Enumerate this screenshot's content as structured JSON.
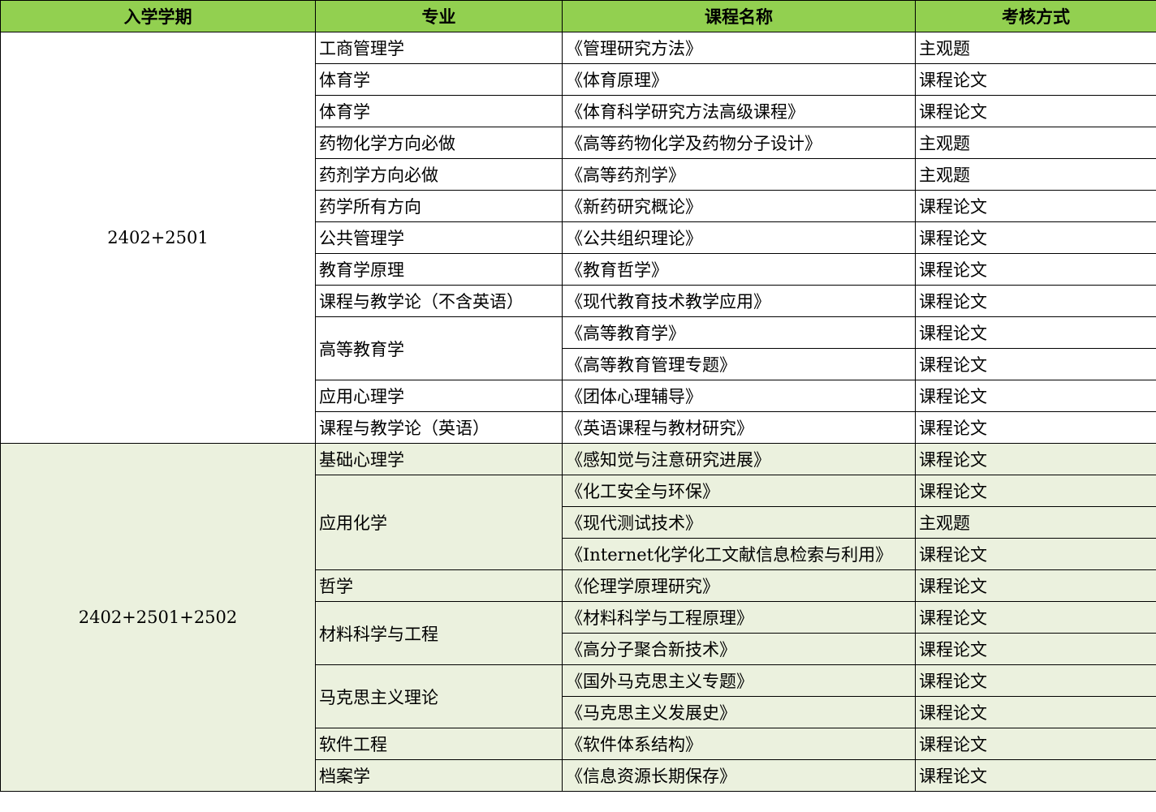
{
  "headers": [
    "入学学期",
    "专业",
    "课程名称",
    "考核方式"
  ],
  "groups": [
    {
      "term": "2402+2501",
      "majors": [
        {
          "name": "工商管理学",
          "courses": [
            {
              "course": "《管理研究方法》",
              "method": "主观题"
            }
          ]
        },
        {
          "name": "体育学",
          "courses": [
            {
              "course": "《体育原理》",
              "method": "课程论文"
            }
          ]
        },
        {
          "name": "体育学",
          "courses": [
            {
              "course": "《体育科学研究方法高级课程》",
              "method": "课程论文"
            }
          ]
        },
        {
          "name": "药物化学方向必做",
          "courses": [
            {
              "course": "《高等药物化学及药物分子设计》",
              "method": "主观题"
            }
          ]
        },
        {
          "name": "药剂学方向必做",
          "courses": [
            {
              "course": "《高等药剂学》",
              "method": "主观题"
            }
          ]
        },
        {
          "name": "药学所有方向",
          "courses": [
            {
              "course": "《新药研究概论》",
              "method": "课程论文"
            }
          ]
        },
        {
          "name": "公共管理学",
          "courses": [
            {
              "course": "《公共组织理论》",
              "method": "课程论文"
            }
          ]
        },
        {
          "name": "教育学原理",
          "courses": [
            {
              "course": "《教育哲学》",
              "method": "课程论文"
            }
          ]
        },
        {
          "name": "课程与教学论（不含英语）",
          "courses": [
            {
              "course": "《现代教育技术教学应用》",
              "method": "课程论文"
            }
          ]
        },
        {
          "name": "高等教育学",
          "courses": [
            {
              "course": "《高等教育学》",
              "method": "课程论文"
            },
            {
              "course": "《高等教育管理专题》",
              "method": "课程论文"
            }
          ]
        },
        {
          "name": "应用心理学",
          "courses": [
            {
              "course": "《团体心理辅导》",
              "method": "课程论文"
            }
          ]
        },
        {
          "name": "课程与教学论（英语）",
          "courses": [
            {
              "course": "《英语课程与教材研究》",
              "method": "课程论文"
            }
          ]
        }
      ]
    },
    {
      "term": "2402+2501+2502",
      "majors": [
        {
          "name": "基础心理学",
          "courses": [
            {
              "course": "《感知觉与注意研究进展》",
              "method": "课程论文"
            }
          ]
        },
        {
          "name": "应用化学",
          "courses": [
            {
              "course": "《化工安全与环保》",
              "method": "课程论文"
            },
            {
              "course": "《现代测试技术》",
              "method": "主观题"
            },
            {
              "course": "《Internet化学化工文献信息检索与利用》",
              "method": "课程论文"
            }
          ]
        },
        {
          "name": "哲学",
          "courses": [
            {
              "course": "《伦理学原理研究》",
              "method": "课程论文"
            }
          ]
        },
        {
          "name": "材料科学与工程",
          "courses": [
            {
              "course": "《材料科学与工程原理》",
              "method": "课程论文"
            },
            {
              "course": "《高分子聚合新技术》",
              "method": "课程论文"
            }
          ]
        },
        {
          "name": "马克思主义理论",
          "courses": [
            {
              "course": "《国外马克思主义专题》",
              "method": "课程论文"
            },
            {
              "course": "《马克思主义发展史》",
              "method": "课程论文"
            }
          ]
        },
        {
          "name": "软件工程",
          "courses": [
            {
              "course": "《软件体系结构》",
              "method": "课程论文"
            }
          ]
        },
        {
          "name": "档案学",
          "courses": [
            {
              "course": "《信息资源长期保存》",
              "method": "课程论文"
            }
          ]
        }
      ]
    }
  ],
  "colors": {
    "header_bg": "#92d050",
    "group2_bg": "#ebf1de",
    "border": "#000000"
  }
}
